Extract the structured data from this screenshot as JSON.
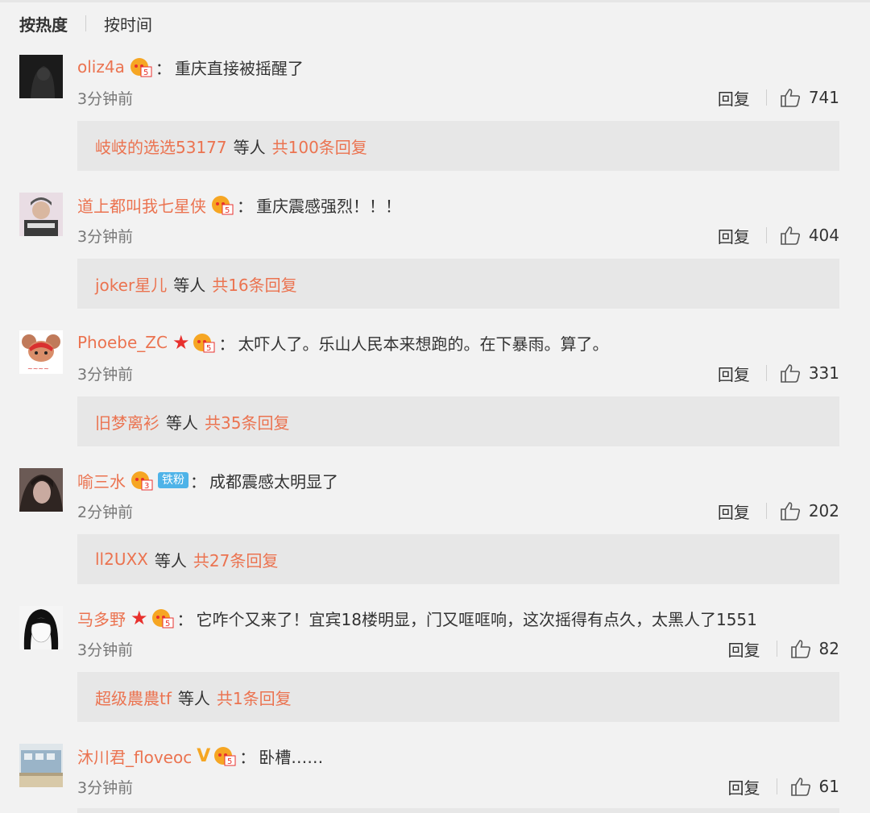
{
  "sort": {
    "hot": "按热度",
    "time": "按时间"
  },
  "labels": {
    "reply": "回复",
    "etc": "等人",
    "colon": "：",
    "fan_badge": "铁粉"
  },
  "colors": {
    "accent": "#eb7350",
    "star": "#e8302d",
    "vip_v": "#f5a623",
    "fan_badge": "#4eb3e8"
  },
  "comments": [
    {
      "user": "oliz4a",
      "badge_icons": [
        "vip-level-icon"
      ],
      "text": "重庆直接被摇醒了",
      "time": "3分钟前",
      "likes": "741",
      "sub_user": "岐岐的选选53177",
      "sub_count": "共100条回复"
    },
    {
      "user": "道上都叫我七星侠",
      "badge_icons": [
        "vip-level-icon"
      ],
      "text": "重庆震感强烈！！！",
      "time": "3分钟前",
      "likes": "404",
      "sub_user": "joker星儿",
      "sub_count": "共16条回复"
    },
    {
      "user": "Phoebe_ZC",
      "badge_icons": [
        "star-icon",
        "vip-level-icon"
      ],
      "text": "太吓人了。乐山人民本来想跑的。在下暴雨。算了。",
      "time": "3分钟前",
      "likes": "331",
      "sub_user": "旧梦离衫",
      "sub_count": "共35条回复"
    },
    {
      "user": "喻三水",
      "badge_icons": [
        "vip-level-icon",
        "fan-badge"
      ],
      "text": "成都震感太明显了",
      "time": "2分钟前",
      "likes": "202",
      "sub_user": "ll2UXX",
      "sub_count": "共27条回复"
    },
    {
      "user": "马多野",
      "badge_icons": [
        "star-icon",
        "vip-level-icon"
      ],
      "text": "它咋个又来了！宜宾18楼明显，门又哐哐响，这次摇得有点久，太黑人了1551",
      "time": "3分钟前",
      "likes": "82",
      "sub_user": "超级農農tf",
      "sub_count": "共1条回复"
    },
    {
      "user": "沐川君_floveoc",
      "badge_icons": [
        "v-verified-icon",
        "vip-level-icon"
      ],
      "text": "卧槽……",
      "time": "3分钟前",
      "likes": "61",
      "sub_user": "",
      "sub_count": ""
    }
  ]
}
